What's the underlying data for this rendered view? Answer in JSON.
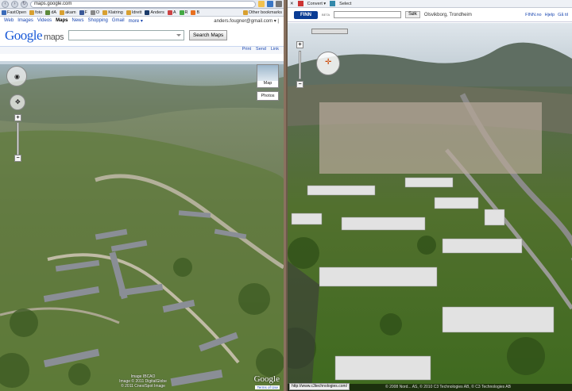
{
  "left": {
    "url": "maps.google.com",
    "bookmarks": [
      "FastOpen",
      "foto",
      "dA",
      "akam",
      "F",
      "O",
      "Klatring",
      "Idrett",
      "Anders",
      "A",
      "R",
      "B",
      "Other bookmarks"
    ],
    "nav": {
      "items": [
        "Web",
        "Images",
        "Videos",
        "Maps",
        "News",
        "Shopping",
        "Gmail",
        "more ▾"
      ],
      "current": "Maps",
      "user": "anders.fougner@gmail.com ▾ |"
    },
    "logo": {
      "brand": "Google",
      "suffix": "maps"
    },
    "search": {
      "value": "",
      "button": "Search Maps"
    },
    "actions": {
      "print": "Print",
      "send": "Send",
      "link": "Link"
    },
    "map_types": {
      "map": "Map",
      "photos": "Photos"
    },
    "credits": {
      "line1": "Image IBCAO",
      "line2": "Image © 2011 DigitalGlobe",
      "line3": "© 2011 Cnes/Spot Image"
    },
    "watermark": "Google",
    "terms": "Terms of Use"
  },
  "right": {
    "toolbar": {
      "convert": "Convert ▾",
      "select": "Select"
    },
    "finn": {
      "logo": "FINN",
      "beta": "BETA",
      "search_value": "",
      "search_button": "Søk",
      "location": "Olsvikborg, Trondheim",
      "links": [
        "FINN.no",
        "Hjelp",
        "Gå til"
      ]
    },
    "status_url": "http://www.c3technologies.com/",
    "copyright": "© 2008 Nord... AS, © 2010 C3 Technologies AB, © C3 Technologies AB"
  }
}
